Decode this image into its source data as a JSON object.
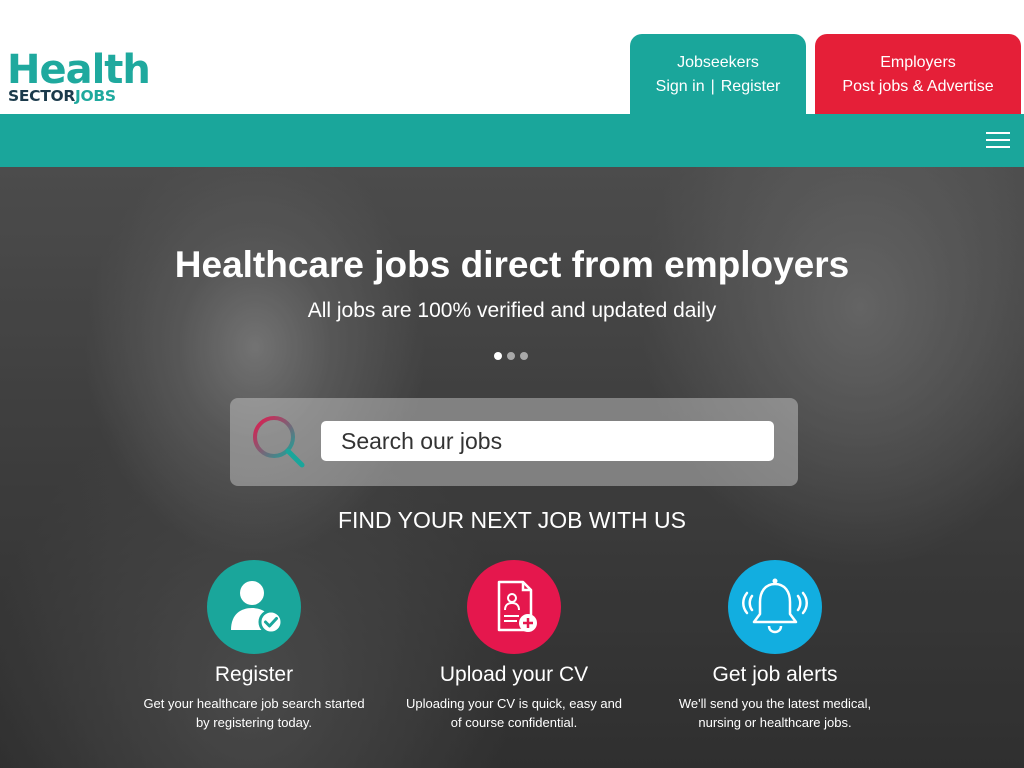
{
  "logo": {
    "health": "Health",
    "sector": "SECTOR",
    "jobs": "JOBS"
  },
  "tabs": {
    "jobseekers": {
      "title": "Jobseekers",
      "sign_in": "Sign in",
      "separator": "|",
      "register": "Register"
    },
    "employers": {
      "title": "Employers",
      "post": "Post jobs & Advertise"
    }
  },
  "hero": {
    "title": "Healthcare jobs direct from employers",
    "subtitle": "All jobs are 100% verified and updated daily",
    "search_placeholder": "Search our jobs",
    "find_title": "FIND YOUR NEXT JOB WITH US"
  },
  "features": [
    {
      "title": "Register",
      "desc": "Get your healthcare job search started by registering today."
    },
    {
      "title": "Upload your CV",
      "desc": "Uploading your CV is quick, easy and of course confidential."
    },
    {
      "title": "Get job alerts",
      "desc": "We'll send you the latest medical, nursing or healthcare jobs."
    }
  ],
  "colors": {
    "teal": "#1aa69b",
    "red": "#e51f38",
    "pink": "#e5174d",
    "blue": "#12aee0"
  },
  "icons": [
    "menu-icon",
    "search-icon",
    "user-check-icon",
    "cv-upload-icon",
    "bell-icon"
  ]
}
